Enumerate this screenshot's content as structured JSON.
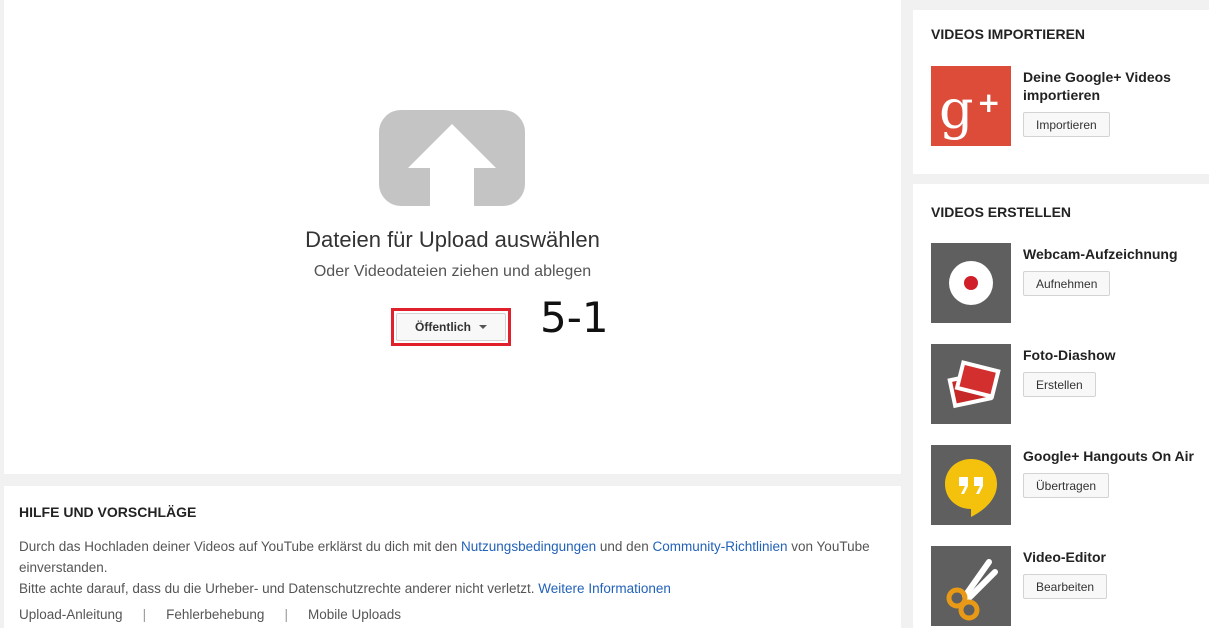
{
  "upload": {
    "title": "Dateien für Upload auswählen",
    "subtitle": "Oder Videodateien ziehen und ablegen",
    "privacy_label": "Öffentlich",
    "step_annotation": "5-1"
  },
  "help": {
    "heading": "HILFE UND VORSCHLÄGE",
    "line1_pre": "Durch das Hochladen deiner Videos auf YouTube erklärst du dich mit den ",
    "terms_link": "Nutzungsbedingungen",
    "line1_mid": " und den ",
    "guidelines_link": "Community-Richtlinien",
    "line1_post": " von YouTube einverstanden.",
    "line2": "Bitte achte darauf, dass du die Urheber- und Datenschutzrechte anderer nicht verletzt. ",
    "more_info_link": "Weitere Informationen",
    "links": [
      "Upload-Anleitung",
      "Fehlerbehebung",
      "Mobile Uploads"
    ]
  },
  "import_section": {
    "heading": "VIDEOS IMPORTIEREN",
    "item": {
      "title": "Deine Google+ Videos importieren",
      "button": "Importieren",
      "icon": "google-plus-icon"
    }
  },
  "create_section": {
    "heading": "VIDEOS ERSTELLEN",
    "items": [
      {
        "title": "Webcam-Aufzeichnung",
        "button": "Aufnehmen",
        "icon": "webcam-record-icon"
      },
      {
        "title": "Foto-Diashow",
        "button": "Erstellen",
        "icon": "photo-slideshow-icon"
      },
      {
        "title": "Google+ Hangouts On Air",
        "button": "Übertragen",
        "icon": "hangouts-icon"
      },
      {
        "title": "Video-Editor",
        "button": "Bearbeiten",
        "icon": "scissors-icon"
      }
    ]
  },
  "colors": {
    "highlight_red": "#e0202a",
    "link_blue": "#2262b8",
    "google_plus_red": "#dd4b39",
    "thumb_gray": "#5f5f5f",
    "hangouts_yellow": "#f4c20d"
  }
}
